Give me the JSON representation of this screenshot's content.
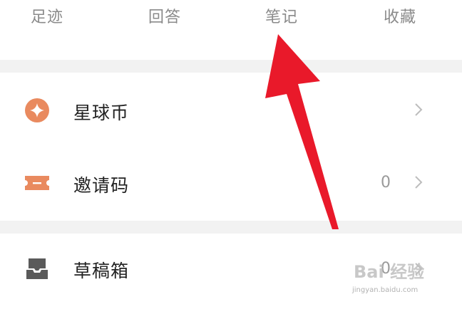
{
  "tabs": [
    {
      "label": "足迹"
    },
    {
      "label": "回答"
    },
    {
      "label": "笔记"
    },
    {
      "label": "收藏"
    }
  ],
  "menu": [
    {
      "label": "星球币",
      "icon": "star-coin-icon",
      "count": "",
      "color": "#e98a5f"
    },
    {
      "label": "邀请码",
      "icon": "ticket-icon",
      "count": "0",
      "color": "#e98a5f"
    },
    {
      "label": "草稿箱",
      "icon": "drafts-tray-icon",
      "count": "0",
      "color": "#5a5a5a"
    }
  ],
  "annotation": {
    "color": "#e9192a"
  },
  "watermark": {
    "logo": "Bai 经验",
    "url": "jingyan.baidu.com"
  }
}
